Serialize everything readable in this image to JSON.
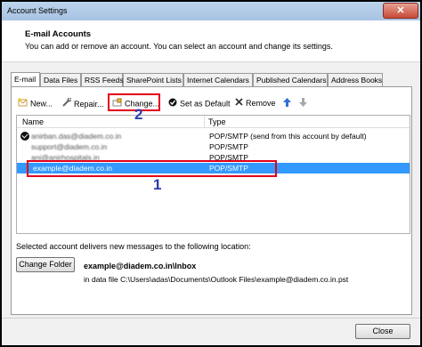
{
  "window": {
    "title": "Account Settings",
    "close_glyph": "✕"
  },
  "header": {
    "title": "E-mail Accounts",
    "subtitle": "You can add or remove an account. You can select an account and change its settings."
  },
  "tabs": [
    {
      "label": "E-mail",
      "active": true
    },
    {
      "label": "Data Files"
    },
    {
      "label": "RSS Feeds"
    },
    {
      "label": "SharePoint Lists"
    },
    {
      "label": "Internet Calendars"
    },
    {
      "label": "Published Calendars"
    },
    {
      "label": "Address Books"
    }
  ],
  "toolbar": {
    "new": "New...",
    "repair": "Repair...",
    "change": "Change...",
    "set_default": "Set as Default",
    "remove": "Remove"
  },
  "list": {
    "columns": {
      "name": "Name",
      "type": "Type"
    },
    "rows": [
      {
        "name": "anirban.das@diadem.co.in",
        "type": "POP/SMTP (send from this account by default)",
        "default": true
      },
      {
        "name": "support@diadem.co.in",
        "type": "POP/SMTP"
      },
      {
        "name": "ani@anirhospitals.in",
        "type": "POP/SMTP"
      },
      {
        "name": "example@diadem.co.in",
        "type": "POP/SMTP",
        "selected": true
      }
    ]
  },
  "annotations": {
    "row_marker": "1",
    "change_marker": "2",
    "color": "#e2001a",
    "number_color": "#2b3fae"
  },
  "delivery": {
    "text": "Selected account delivers new messages to the following location:",
    "change_folder": "Change Folder",
    "folder": "example@diadem.co.in\\Inbox",
    "datafile": "in data file C:\\Users\\adas\\Documents\\Outlook Files\\example@diadem.co.in.pst"
  },
  "footer": {
    "close": "Close"
  },
  "colors": {
    "selection": "#3399ff",
    "titlebar": "#bcd3ec"
  }
}
